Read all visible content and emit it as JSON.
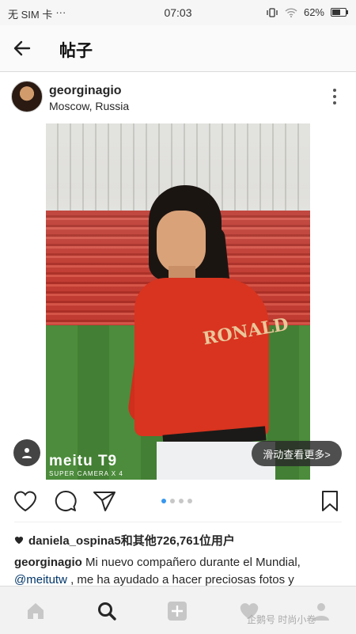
{
  "status_bar": {
    "carrier": "无 SIM 卡",
    "extra": "···",
    "time": "07:03",
    "battery_percent": "62%",
    "battery_level": 0.62
  },
  "header": {
    "title": "帖子"
  },
  "post": {
    "username": "georginagio",
    "location": "Moscow, Russia",
    "photo_watermark": "meitu T9",
    "photo_watermark_sub": "SUPER CAMERA X 4",
    "jersey_text": "RONALD",
    "swipe_hint": "滑动查看更多>",
    "carousel_total": 4,
    "carousel_active": 1,
    "likes_text": "daniela_ospina5和其他726,761位用户",
    "caption_user": "georginagio",
    "caption_text": " Mi nuevo compañero durante el Mundial,",
    "caption_mention": "@meitutw",
    "caption_text2": " , me ha ayudado a hacer preciosas fotos y"
  },
  "bottom_nav": {
    "watermark_text": "企鹅号 时尚小卷"
  },
  "colors": {
    "accent": "#3897f0",
    "text": "#262626",
    "mention": "#003569"
  }
}
